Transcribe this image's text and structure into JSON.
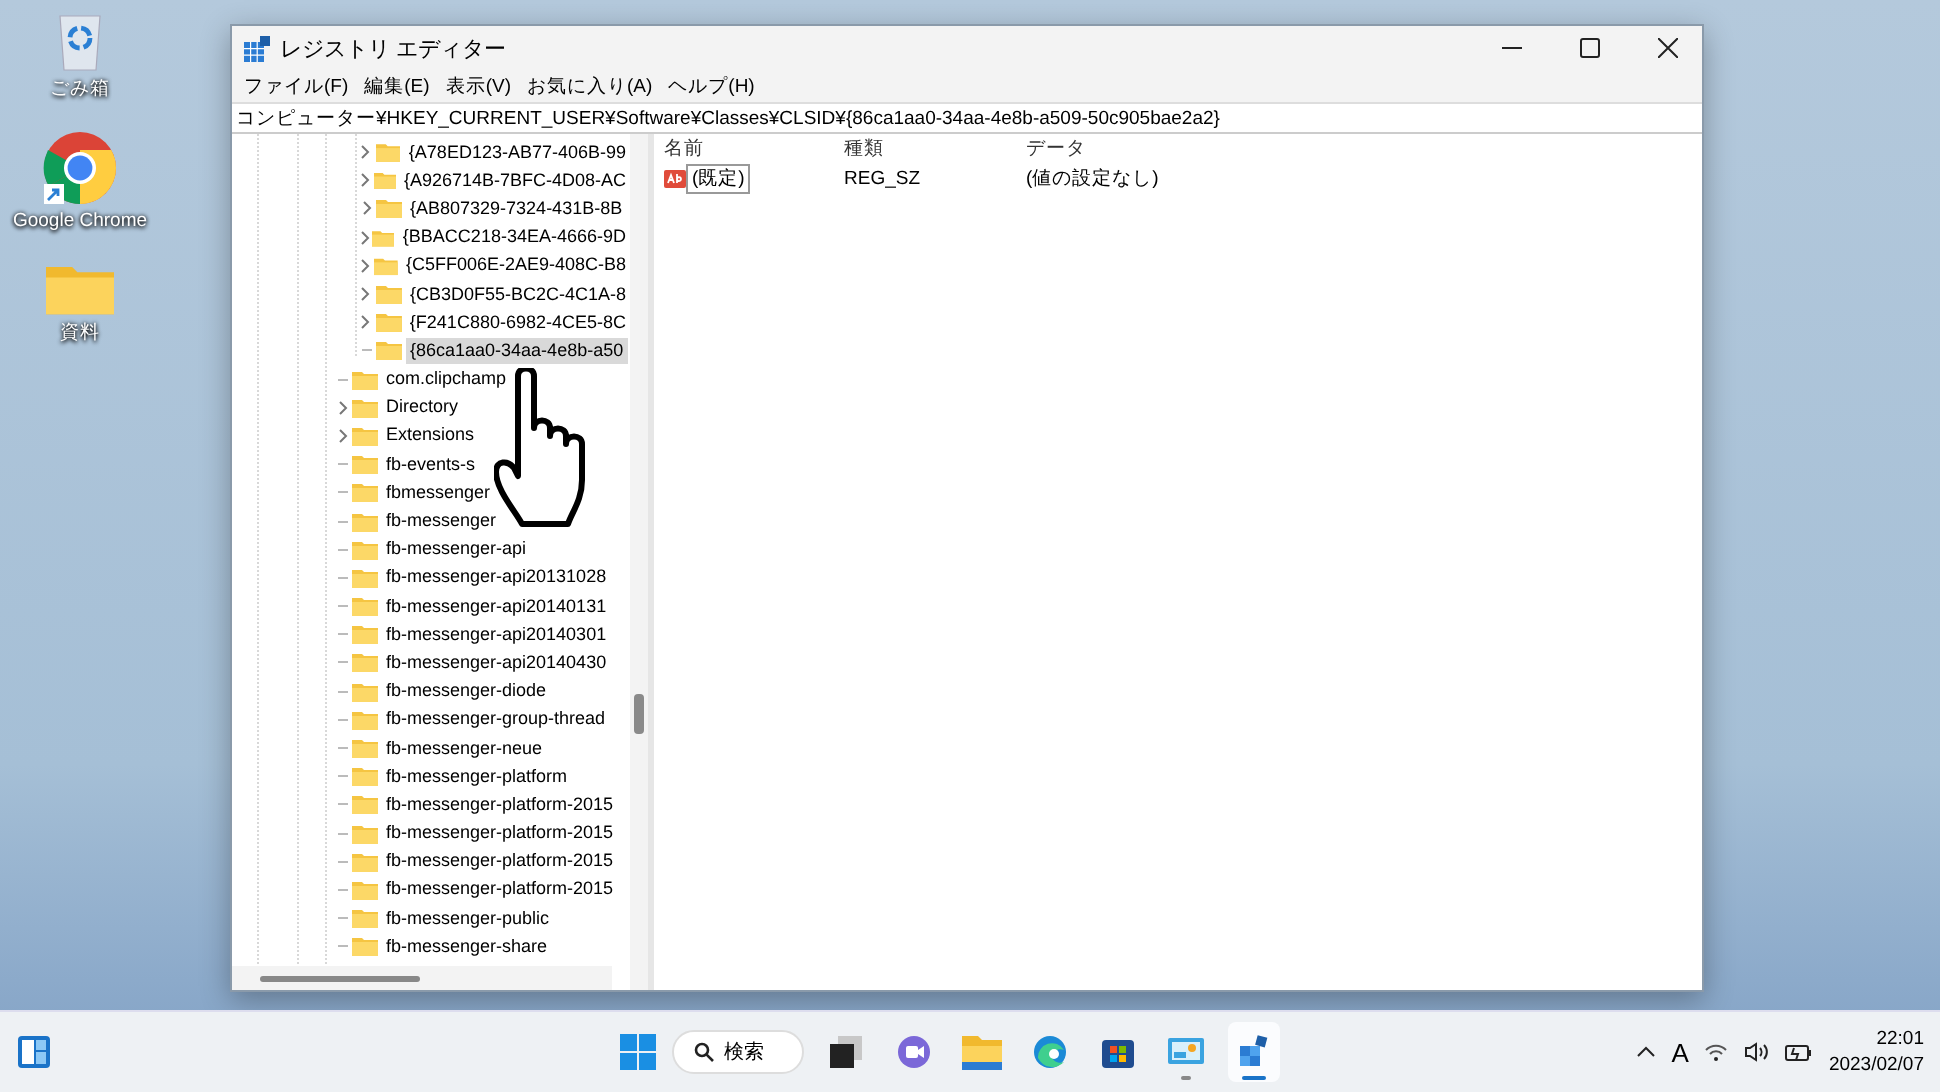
{
  "desktop_icons": [
    {
      "kind": "recycle",
      "label": "ごみ箱"
    },
    {
      "kind": "chrome",
      "label": "Google Chrome"
    },
    {
      "kind": "folder",
      "label": "資料"
    }
  ],
  "window": {
    "title": "レジストリ エディター"
  },
  "menu": [
    "ファイル(F)",
    "編集(E)",
    "表示(V)",
    "お気に入り(A)",
    "ヘルプ(H)"
  ],
  "address": "コンピューター¥HKEY_CURRENT_USER¥Software¥Classes¥CLSID¥{86ca1aa0-34aa-4e8b-a509-50c905bae2a2}",
  "tree": {
    "items": [
      {
        "children": [
          {
            "label": "{A78ED123-AB77-406B-99",
            "has_children": true,
            "selected": false
          },
          {
            "label": "{A926714B-7BFC-4D08-AC",
            "has_children": true,
            "selected": false
          },
          {
            "label": "{AB807329-7324-431B-8B",
            "has_children": true,
            "selected": false
          },
          {
            "label": "{BBACC218-34EA-4666-9D",
            "has_children": true,
            "selected": false
          },
          {
            "label": "{C5FF006E-2AE9-408C-B8",
            "has_children": true,
            "selected": false
          },
          {
            "label": "{CB3D0F55-BC2C-4C1A-8",
            "has_children": true,
            "selected": false
          },
          {
            "label": "{F241C880-6982-4CE5-8C",
            "has_children": true,
            "selected": false
          },
          {
            "label": "{86ca1aa0-34aa-4e8b-a50",
            "has_children": false,
            "selected": true
          }
        ]
      },
      {
        "label": "com.clipchamp",
        "has_children": false,
        "selected": false
      },
      {
        "label": "Directory",
        "has_children": true,
        "selected": false
      },
      {
        "label": "Extensions",
        "has_children": true,
        "selected": false
      },
      {
        "label": "fb-events-s",
        "has_children": false,
        "selected": false
      },
      {
        "label": "fbmessenger",
        "has_children": false,
        "selected": false
      },
      {
        "label": "fb-messenger",
        "has_children": false,
        "selected": false
      },
      {
        "label": "fb-messenger-api",
        "has_children": false,
        "selected": false
      },
      {
        "label": "fb-messenger-api20131028",
        "has_children": false,
        "selected": false
      },
      {
        "label": "fb-messenger-api20140131",
        "has_children": false,
        "selected": false
      },
      {
        "label": "fb-messenger-api20140301",
        "has_children": false,
        "selected": false
      },
      {
        "label": "fb-messenger-api20140430",
        "has_children": false,
        "selected": false
      },
      {
        "label": "fb-messenger-diode",
        "has_children": false,
        "selected": false
      },
      {
        "label": "fb-messenger-group-thread",
        "has_children": false,
        "selected": false
      },
      {
        "label": "fb-messenger-neue",
        "has_children": false,
        "selected": false
      },
      {
        "label": "fb-messenger-platform",
        "has_children": false,
        "selected": false
      },
      {
        "label": "fb-messenger-platform-2015",
        "has_children": false,
        "selected": false
      },
      {
        "label": "fb-messenger-platform-2015",
        "has_children": false,
        "selected": false
      },
      {
        "label": "fb-messenger-platform-2015",
        "has_children": false,
        "selected": false
      },
      {
        "label": "fb-messenger-platform-2015",
        "has_children": false,
        "selected": false
      },
      {
        "label": "fb-messenger-public",
        "has_children": false,
        "selected": false
      },
      {
        "label": "fb-messenger-share",
        "has_children": false,
        "selected": false
      }
    ]
  },
  "values": {
    "columns": [
      "名前",
      "種類",
      "データ"
    ],
    "rows": [
      {
        "name": "(既定)",
        "type": "REG_SZ",
        "data": "(値の設定なし)",
        "selected": true
      }
    ]
  },
  "taskbar": {
    "search": "検索",
    "apps": [
      {
        "kind": "taskview",
        "running": false,
        "active": false
      },
      {
        "kind": "chat",
        "running": false,
        "active": false
      },
      {
        "kind": "explorer",
        "running": false,
        "active": false
      },
      {
        "kind": "edge",
        "running": false,
        "active": false
      },
      {
        "kind": "store",
        "running": false,
        "active": false
      },
      {
        "kind": "photos",
        "running": true,
        "active": false
      },
      {
        "kind": "regedit",
        "running": true,
        "active": true
      }
    ],
    "ime": "A",
    "time": "22:01",
    "date": "2023/02/07"
  }
}
